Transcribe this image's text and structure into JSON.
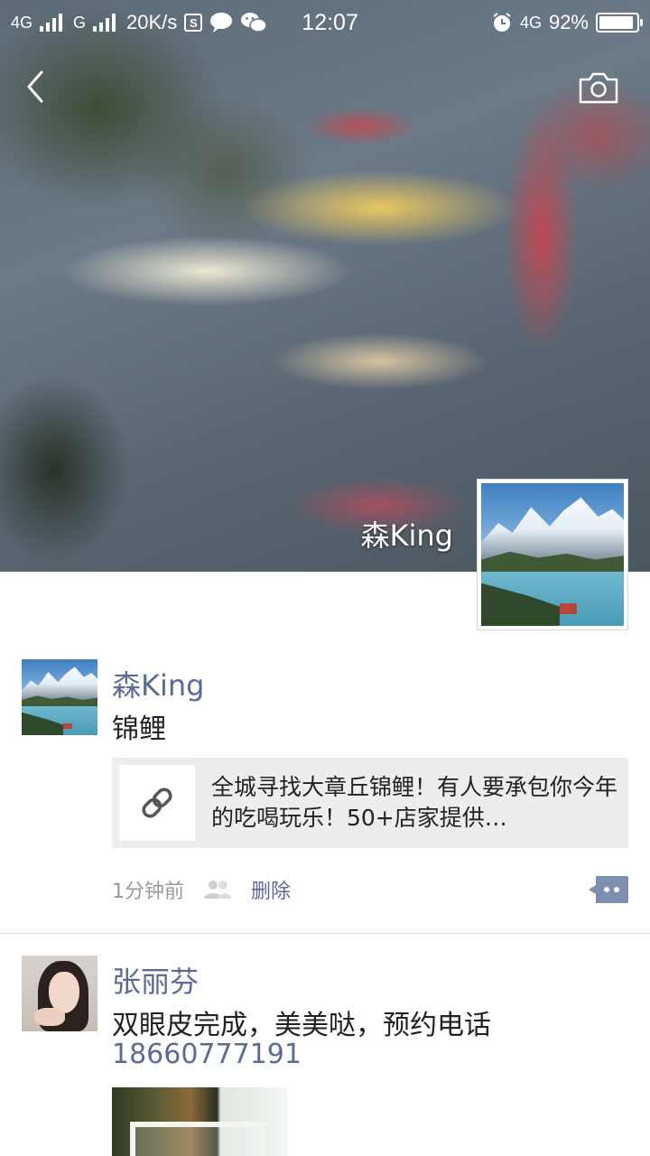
{
  "status_bar": {
    "network1": "4G",
    "network2": "G",
    "speed": "20K/s",
    "s_badge": "S",
    "time": "12:07",
    "network3": "4G",
    "battery_text": "92%",
    "battery_level": 0.92
  },
  "cover": {
    "username": "森King"
  },
  "posts": [
    {
      "name": "森King",
      "text": "锦鲤",
      "link_title": "全城寻找大章丘锦鲤！有人要承包你今年的吃喝玩乐！50+店家提供…",
      "time": "1分钟前",
      "delete_label": "删除"
    },
    {
      "name": "张丽芬",
      "text": "双眼皮完成，美美哒，预约电话",
      "phone": "18660777191"
    }
  ],
  "colors": {
    "link_blue": "#5b6b94",
    "meta_gray": "#9a9a9a",
    "card_bg": "#ededed"
  }
}
